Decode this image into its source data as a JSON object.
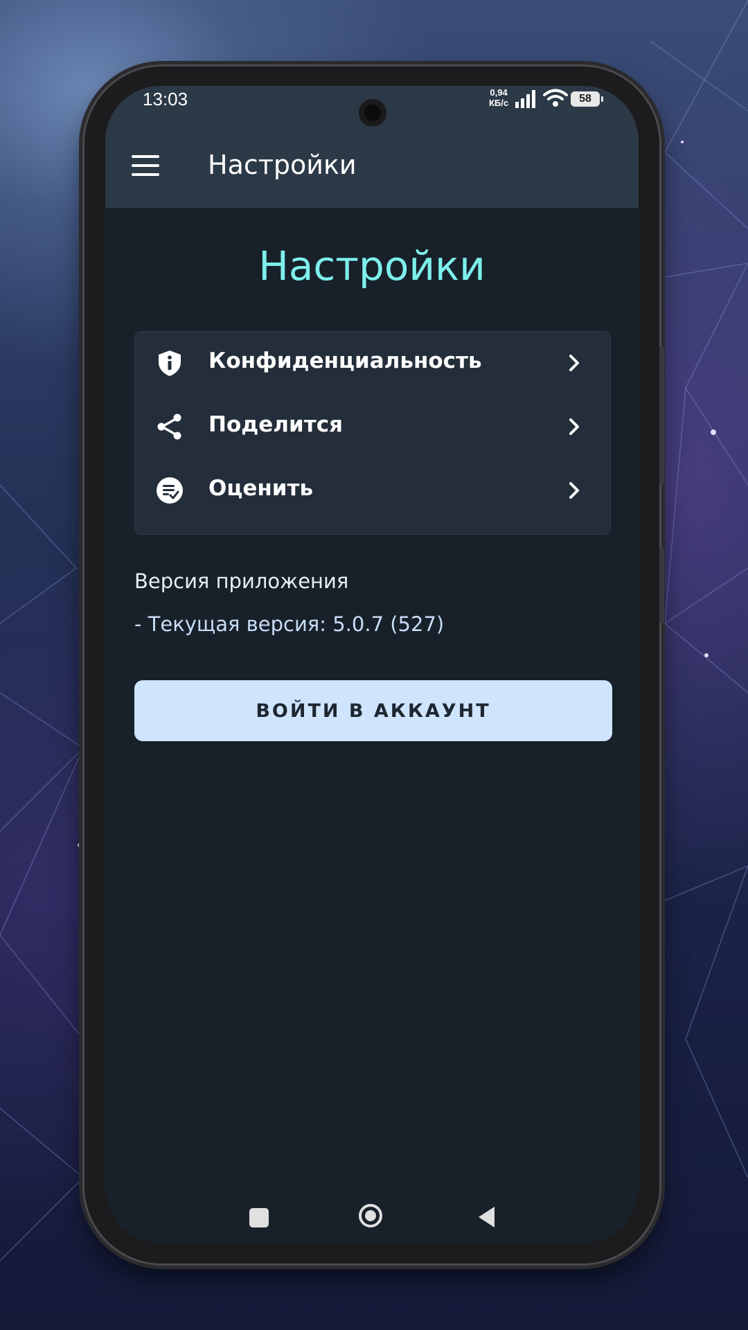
{
  "status_bar": {
    "time": "13:03",
    "net_speed_value": "0,94",
    "net_speed_unit": "КБ/с",
    "battery": "58"
  },
  "app_bar": {
    "title": "Настройки",
    "menu_icon": "hamburger-menu-icon"
  },
  "main": {
    "heading": "Настройки",
    "heading_color": "#7df0ec",
    "menu_items": [
      {
        "label": "Конфиденциальность",
        "icon": "shield-info-icon"
      },
      {
        "label": "Поделится",
        "icon": "share-icon"
      },
      {
        "label": "Оценить",
        "icon": "rate-icon"
      }
    ],
    "version_heading": "Версия приложения",
    "version_line": "- Текущая версия: 5.0.7 (527)",
    "login_button": "ВОЙТИ В АККАУНТ"
  },
  "nav_bar": {
    "recents": "square-icon",
    "home": "circle-icon",
    "back": "triangle-back-icon"
  }
}
